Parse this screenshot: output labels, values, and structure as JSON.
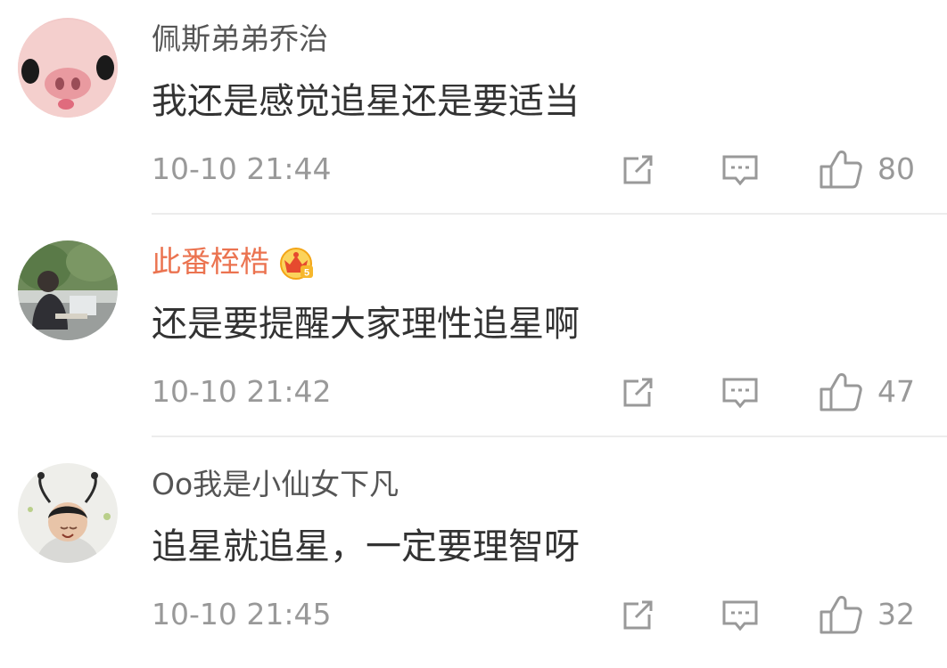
{
  "comments": [
    {
      "avatar": "pig-avatar",
      "name": "佩斯弟弟乔治",
      "vip": false,
      "text": "我还是感觉追星还是要适当",
      "time": "10-10 21:44",
      "likes": "80"
    },
    {
      "avatar": "outdoor-photo-avatar",
      "name": "此番桎梏",
      "vip": true,
      "badge": "crown-badge-5-icon",
      "text": "还是要提醒大家理性追星啊",
      "time": "10-10 21:42",
      "likes": "47"
    },
    {
      "avatar": "child-photo-avatar",
      "name": "Oo我是小仙女下凡",
      "vip": false,
      "text": "追星就追星，一定要理智呀",
      "time": "10-10 21:45",
      "likes": "32"
    }
  ],
  "icons": {
    "share": "share-icon",
    "reply": "comment-icon",
    "like": "thumbs-up-icon"
  },
  "colors": {
    "vip_name": "#eb7350",
    "meta": "#999999",
    "text": "#333333"
  }
}
